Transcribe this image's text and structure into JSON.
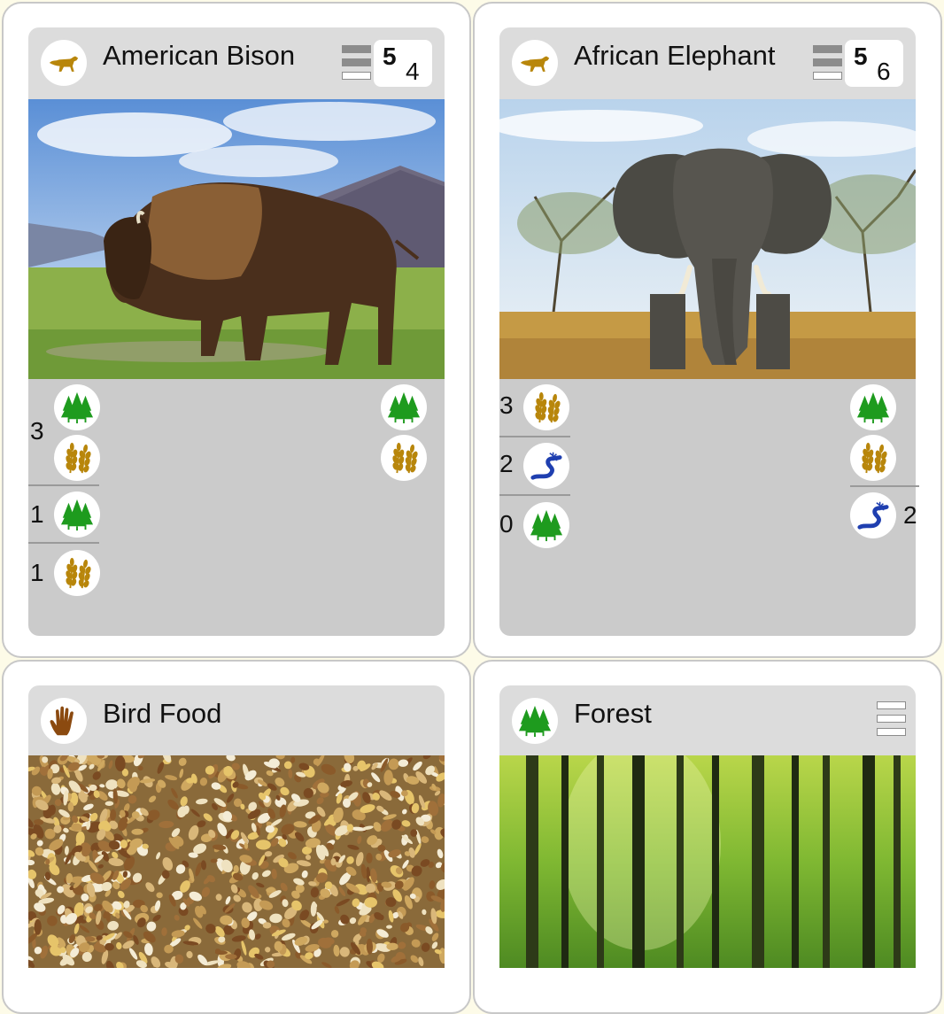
{
  "cards": [
    {
      "title": "American Bison",
      "type_icon": "animal-icon",
      "score": {
        "main": "5",
        "sub": "4"
      },
      "panel": {
        "left_rows": [
          {
            "count": "3",
            "icons": [
              "forest-icon",
              "grain-icon"
            ]
          },
          {
            "count": "1",
            "icons": [
              "forest-icon"
            ]
          },
          {
            "count": "1",
            "icons": [
              "grain-icon"
            ]
          }
        ],
        "right_icons": [
          "forest-icon",
          "grain-icon"
        ]
      }
    },
    {
      "title": "African Elephant",
      "type_icon": "animal-icon",
      "score": {
        "main": "5",
        "sub": "6"
      },
      "panel": {
        "left_rows": [
          {
            "count": "3",
            "icons": [
              "grain-icon"
            ]
          },
          {
            "count": "2",
            "icons": [
              "water-icon"
            ]
          },
          {
            "count": "0",
            "icons": [
              "forest-icon"
            ]
          }
        ],
        "right_icons": [
          "forest-icon",
          "grain-icon"
        ],
        "right_extra": {
          "count": "2",
          "icon": "water-icon"
        }
      }
    },
    {
      "title": "Bird Food",
      "type_icon": "hand-icon"
    },
    {
      "title": "Forest",
      "type_icon": "forest-icon"
    }
  ],
  "colors": {
    "forest": "#1e9b1e",
    "grain": "#b8860b",
    "water": "#1f3fb0",
    "hand": "#8b4a10",
    "animal": "#b8860b"
  }
}
